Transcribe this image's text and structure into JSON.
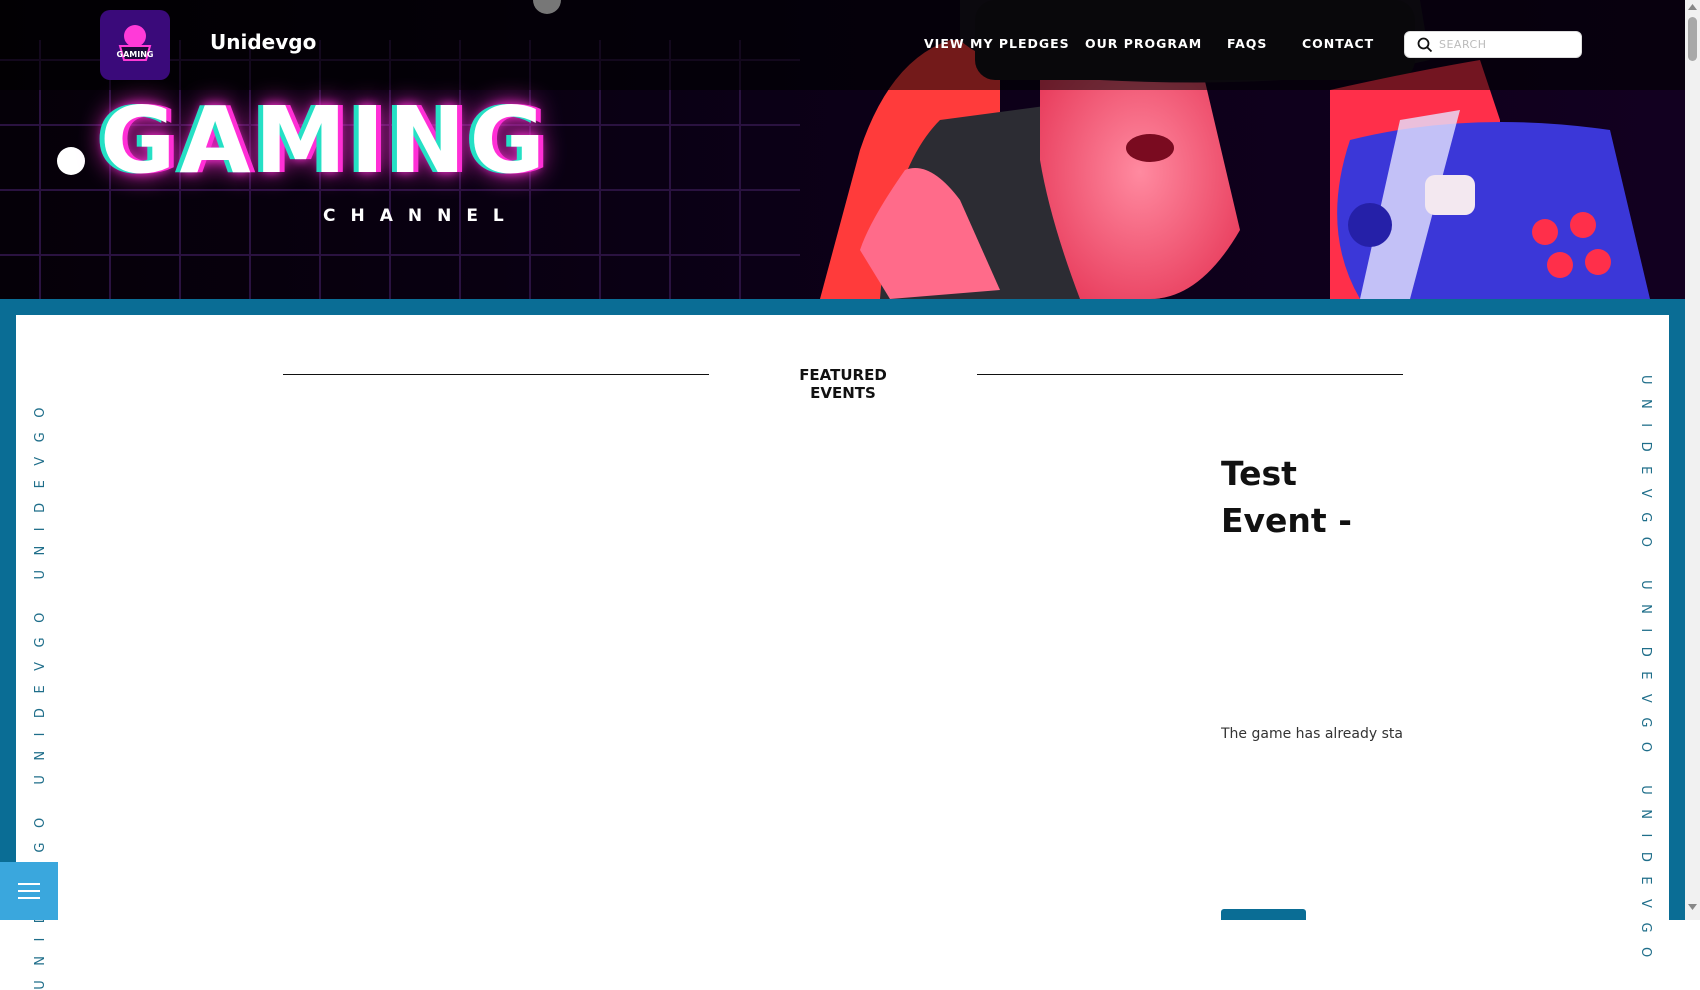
{
  "brand": {
    "logo_text": "GAMING",
    "name": "Unidevgo"
  },
  "nav": {
    "links": [
      "VIEW MY PLEDGES",
      "OUR PROGRAM",
      "FAQS",
      "CONTACT"
    ],
    "search_placeholder": "SEARCH"
  },
  "hero": {
    "title": "GAMING",
    "subtitle": "CHANNEL"
  },
  "side_text": "UNIDEVGO UNIDEVGO UNIDEVGO",
  "featured": {
    "section_title": "FEATURED EVENTS",
    "event_title": "Test Event - David",
    "event_text": "The game has already started"
  },
  "colors": {
    "frame": "#0a6d95",
    "menu_button": "#3aa7dd",
    "neon_pink": "#ff2fd6",
    "neon_cyan": "#25e0c5"
  },
  "icons": {
    "search": "search-icon",
    "menu": "hamburger-menu-icon",
    "scroll_up": "chevron-up-icon",
    "scroll_down": "chevron-down-icon"
  }
}
